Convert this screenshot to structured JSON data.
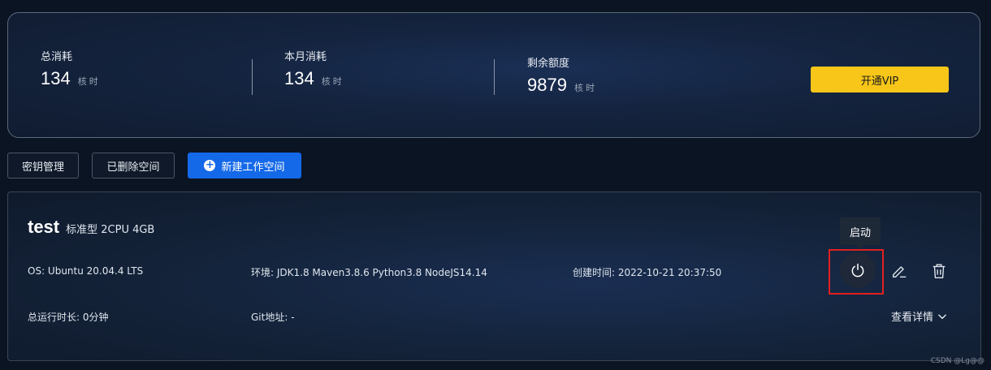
{
  "stats": [
    {
      "label": "总消耗",
      "value": "134",
      "unit": "核时"
    },
    {
      "label": "本月消耗",
      "value": "134",
      "unit": "核时"
    },
    {
      "label": "剩余额度",
      "value": "9879",
      "unit": "核时"
    }
  ],
  "vip_button": "开通VIP",
  "toolbar": {
    "keys_label": "密钥管理",
    "deleted_label": "已删除空间",
    "new_label": "新建工作空间"
  },
  "workspace": {
    "name": "test",
    "spec": "标准型 2CPU 4GB",
    "os": "OS: Ubuntu 20.04.4 LTS",
    "env": "环境: JDK1.8 Maven3.8.6 Python3.8 NodeJS14.14",
    "created": "创建时间: 2022-10-21 20:37:50",
    "runtime": "总运行时长: 0分钟",
    "git": "Git地址: -",
    "tooltip": "启动",
    "details": "查看详情"
  },
  "watermark": "CSDN @Lg@@",
  "colors": {
    "accent": "#1469e8",
    "vip": "#f7c619",
    "highlight": "#e02020",
    "background": "#0b1422"
  }
}
